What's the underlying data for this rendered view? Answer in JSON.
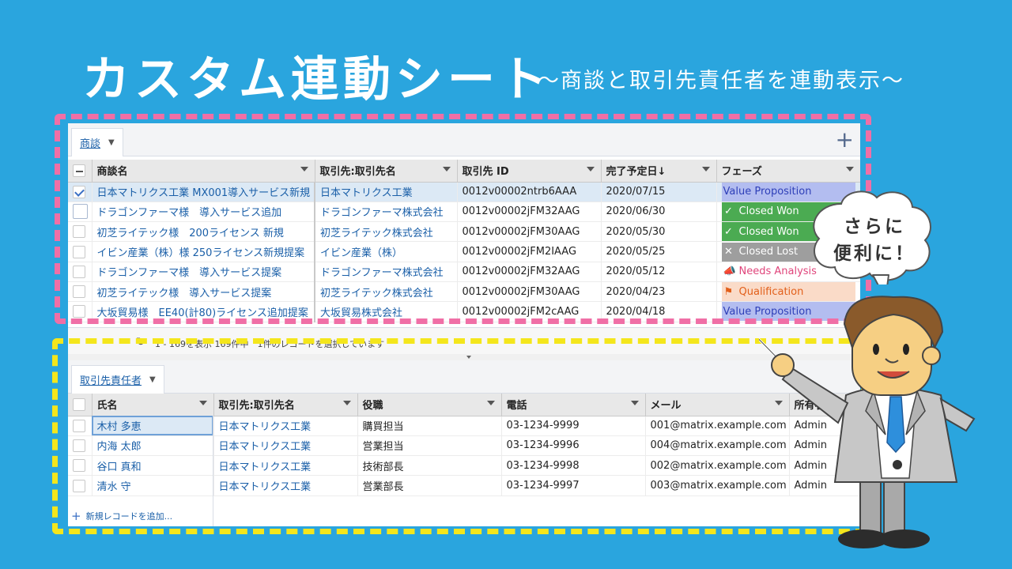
{
  "header": {
    "title": "カスタム連動シート",
    "subtitle": "～商談と取引先責任者を連動表示～"
  },
  "top_sheet": {
    "tab_label": "商談",
    "columns": [
      "商談名",
      "取引先:取引先名",
      "取引先 ID",
      "完了予定日↓",
      "フェーズ"
    ],
    "rows": [
      {
        "name": "日本マトリクス工業 MX001導入サービス新規",
        "account": "日本マトリクス工業",
        "account_id": "0012v00002ntrb6AAA",
        "close_date": "2020/07/15",
        "phase": "Value Proposition",
        "phase_style": "vp",
        "phase_icon": "",
        "checked": true
      },
      {
        "name": "ドラゴンファーマ様　導入サービス追加",
        "account": "ドラゴンファーマ株式会社",
        "account_id": "0012v00002jFM32AAG",
        "close_date": "2020/06/30",
        "phase": "Closed Won",
        "phase_style": "won",
        "phase_icon": "✓",
        "checked": false
      },
      {
        "name": "初芝ライテック様　200ライセンス 新規",
        "account": "初芝ライテック株式会社",
        "account_id": "0012v00002jFM30AAG",
        "close_date": "2020/05/30",
        "phase": "Closed Won",
        "phase_style": "won",
        "phase_icon": "✓",
        "checked": false
      },
      {
        "name": "イビン産業（株）様 250ライセンス新規提案",
        "account": "イビン産業（株）",
        "account_id": "0012v00002jFM2IAAG",
        "close_date": "2020/05/25",
        "phase": "Closed Lost",
        "phase_style": "lost",
        "phase_icon": "✕",
        "checked": false
      },
      {
        "name": "ドラゴンファーマ様　導入サービス提案",
        "account": "ドラゴンファーマ株式会社",
        "account_id": "0012v00002jFM32AAG",
        "close_date": "2020/05/12",
        "phase": "Needs Analysis",
        "phase_style": "na",
        "phase_icon": "📣",
        "checked": false
      },
      {
        "name": "初芝ライテック様　導入サービス提案",
        "account": "初芝ライテック株式会社",
        "account_id": "0012v00002jFM30AAG",
        "close_date": "2020/04/23",
        "phase": "Qualification",
        "phase_style": "qual",
        "phase_icon": "⚑",
        "checked": false
      },
      {
        "name": "大坂貿易様　EE40(計80)ライセンス追加提案",
        "account": "大坂貿易株式会社",
        "account_id": "0012v00002jFM2cAAG",
        "close_date": "2020/04/18",
        "phase": "Value Proposition",
        "phase_style": "vp",
        "phase_icon": "",
        "checked": false
      }
    ],
    "footer_text": "1 - 169を表示 169件中　1件のレコードを選択しています"
  },
  "bottom_sheet": {
    "tab_label": "取引先責任者",
    "columns": [
      "氏名",
      "取引先:取引先名",
      "役職",
      "電話",
      "メール",
      "所有者"
    ],
    "rows": [
      {
        "name": "木村 多恵",
        "account": "日本マトリクス工業",
        "title": "購買担当",
        "phone": "03-1234-9999",
        "email": "001@matrix.example.com",
        "owner": "Admin"
      },
      {
        "name": "内海 太郎",
        "account": "日本マトリクス工業",
        "title": "営業担当",
        "phone": "03-1234-9996",
        "email": "004@matrix.example.com",
        "owner": "Admin"
      },
      {
        "name": "谷口 真和",
        "account": "日本マトリクス工業",
        "title": "技術部長",
        "phone": "03-1234-9998",
        "email": "002@matrix.example.com",
        "owner": "Admin"
      },
      {
        "name": "清水 守",
        "account": "日本マトリクス工業",
        "title": "営業部長",
        "phone": "03-1234-9997",
        "email": "003@matrix.example.com",
        "owner": "Admin"
      }
    ],
    "add_record_label": "新規レコードを追加..."
  },
  "bubble": {
    "line1": "さらに",
    "line2": "便利に！"
  },
  "colors": {
    "background": "#2aa5de",
    "pink_dash": "#f06fa6",
    "yellow_dash": "#f4e61c",
    "link": "#1a5fa8"
  }
}
